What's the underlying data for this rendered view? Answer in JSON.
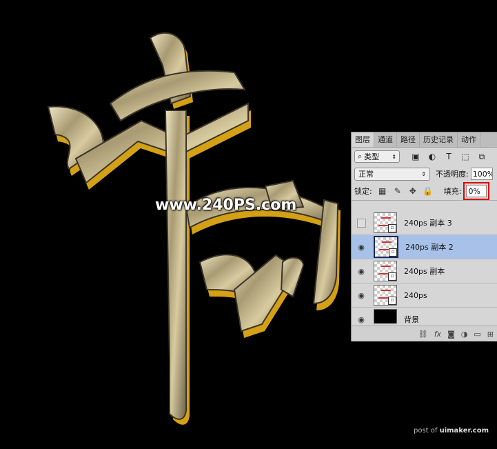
{
  "watermark": "www.240PS.com",
  "credit": {
    "prefix": "post of ",
    "site": "uimaker.com"
  },
  "panel": {
    "tabs": [
      "图层",
      "通道",
      "路径",
      "历史记录",
      "动作"
    ],
    "filter": {
      "kind": "类型",
      "icons": [
        "image-filter-icon",
        "adjustment-filter-icon",
        "type-filter-icon",
        "shape-filter-icon",
        "smart-object-filter-icon"
      ]
    },
    "blend_mode": "正常",
    "opacity_label": "不透明度:",
    "opacity_value": "100%",
    "lock_label": "锁定:",
    "fill_label": "填充:",
    "fill_value": "0%",
    "layers": [
      {
        "name": "240ps 副本 3",
        "visible": false,
        "selected": false
      },
      {
        "name": "240ps 副本 2",
        "visible": true,
        "selected": true
      },
      {
        "name": "240ps 副本",
        "visible": true,
        "selected": false
      },
      {
        "name": "240ps",
        "visible": true,
        "selected": false
      },
      {
        "name": "背景",
        "visible": true,
        "selected": false
      }
    ],
    "bottom_icons": [
      "link-icon",
      "fx-icon",
      "mask-icon",
      "adjustment-icon",
      "group-folder-icon",
      "new-layer-icon"
    ]
  },
  "colors": {
    "background": "#000000",
    "gold": "#d4a015",
    "selected_row": "#a8c1e8",
    "highlight_box": "#e00000"
  }
}
